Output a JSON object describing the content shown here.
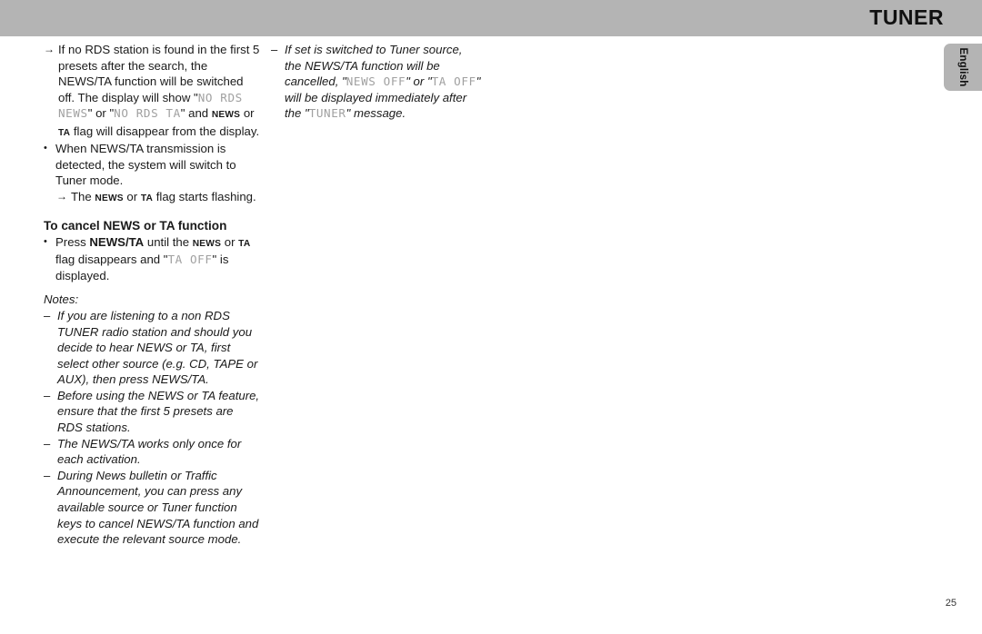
{
  "header": {
    "title": "TUNER",
    "band_color": "#b4b4b4"
  },
  "language_tab": {
    "label": "English"
  },
  "markers": {
    "bullet": "•",
    "arrow": "→",
    "dash": "–"
  },
  "left_column": {
    "arrow_item_1": {
      "line_1_pre": "If no RDS station is found in the first 5 presets after the search, the NEWS/TA function will be switched off.  The display will show \"",
      "lcd_1": "NO RDS NEWS",
      "mid_1": "\" or \"",
      "lcd_2": "NO RDS TA",
      "mid_2": "\" and ",
      "flag_news": "NEWS",
      "mid_3": " or ",
      "flag_ta": "TA",
      "tail": " flag will disappear from the display."
    },
    "bullet_item_1": {
      "text": "When NEWS/TA transmission is detected, the system will switch to Tuner mode."
    },
    "arrow_item_2": {
      "pre": "The ",
      "flag_news": "NEWS",
      "mid": " or ",
      "flag_ta": "TA",
      "tail": " flag starts flashing."
    },
    "heading": "To cancel NEWS or TA function",
    "bullet_item_2": {
      "pre": "Press ",
      "bold_btn": "NEWS/TA",
      "mid_1": " until the ",
      "flag_news": "NEWS",
      "mid_2": " or ",
      "flag_ta": "TA",
      "mid_3": " flag disappears and \"",
      "lcd": "TA OFF",
      "tail": "\" is displayed."
    },
    "notes_label": "Notes:",
    "notes": [
      "If you are listening to a non RDS TUNER radio station and should you decide to hear NEWS or TA, first select other source (e.g. CD, TAPE or AUX), then press NEWS/TA.",
      "Before using the NEWS or TA feature, ensure that the first 5 presets are RDS stations.",
      "The NEWS/TA works only once for each activation.",
      "During News bulletin or Traffic Announcement, you can press any available source or Tuner function keys to cancel NEWS/TA function and execute the relevant source mode."
    ]
  },
  "right_column": {
    "note_1": {
      "pre": "If set is switched to Tuner source, the NEWS/TA function will be cancelled, \"",
      "lcd_1": "NEWS OFF",
      "mid_1": "\" or \"",
      "lcd_2": "TA OFF",
      "mid_2": "\" will be displayed immediately after the \"",
      "lcd_3": "TUNER",
      "tail": "\" message."
    }
  },
  "footer": {
    "page_number": "25"
  }
}
